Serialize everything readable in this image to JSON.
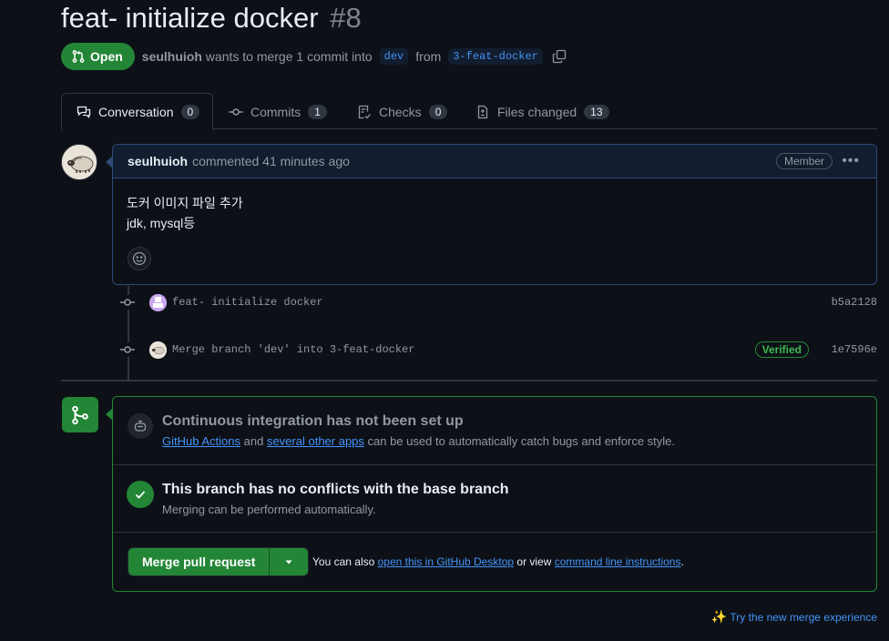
{
  "pr": {
    "title": "feat- initialize docker",
    "number": "#8",
    "state": "Open",
    "author": "seulhuioh",
    "merge_text_1": "wants to merge 1 commit into",
    "base_branch": "dev",
    "from_text": "from",
    "head_branch": "3-feat-docker"
  },
  "tabs": [
    {
      "label": "Conversation",
      "count": "0"
    },
    {
      "label": "Commits",
      "count": "1"
    },
    {
      "label": "Checks",
      "count": "0"
    },
    {
      "label": "Files changed",
      "count": "13"
    }
  ],
  "comment": {
    "author": "seulhuioh",
    "when": "commented 41 minutes ago",
    "badge": "Member",
    "body_line1": "도커 이미지 파일 추가",
    "body_line2": "jdk, mysql등"
  },
  "commits": [
    {
      "message": "feat- initialize docker",
      "sha": "b5a2128",
      "verified": ""
    },
    {
      "message": "Merge branch 'dev' into 3-feat-docker",
      "sha": "1e7596e",
      "verified": "Verified"
    }
  ],
  "merge_box": {
    "ci_title": "Continuous integration has not been set up",
    "ci_link1": "GitHub Actions",
    "ci_and": "and",
    "ci_link2": "several other apps",
    "ci_rest": "can be used to automatically catch bugs and enforce style.",
    "conflict_title": "This branch has no conflicts with the base branch",
    "conflict_sub": "Merging can be performed automatically.",
    "merge_button": "Merge pull request",
    "hint_prefix": "You can also",
    "hint_link1": "open this in GitHub Desktop",
    "hint_mid": "or view",
    "hint_link2": "command line instructions",
    "hint_suffix": "."
  },
  "footer": {
    "try_link": "Try the new merge experience"
  },
  "colors": {
    "background": "#0d1117",
    "accent_green": "#238636",
    "link_blue": "#4493f8",
    "muted": "#9198a1"
  }
}
